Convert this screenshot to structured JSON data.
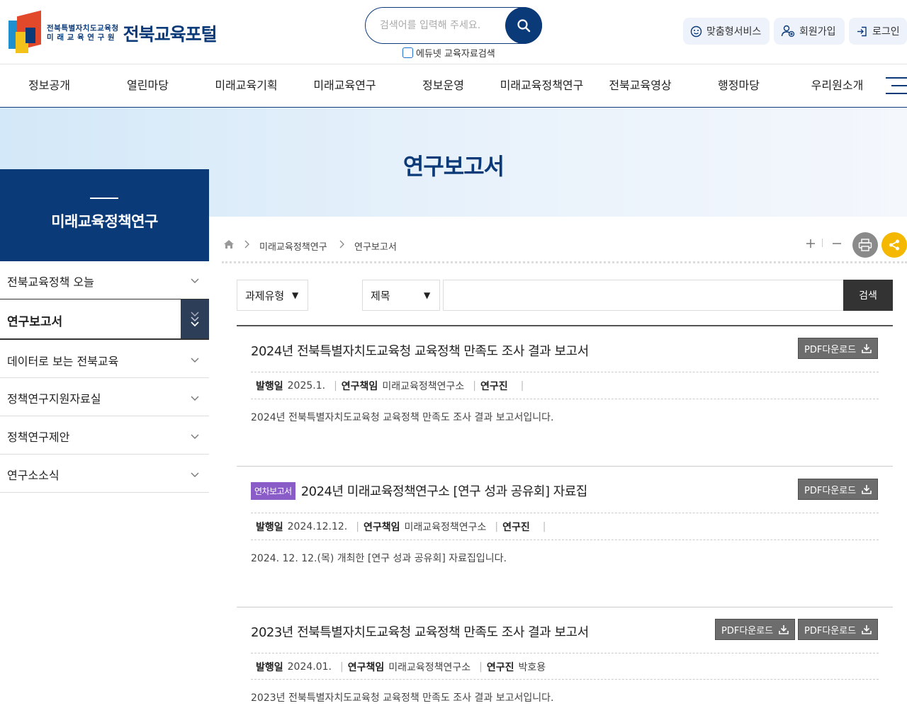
{
  "header": {
    "logo_line1": "전북특별자치도교육청",
    "logo_line2": "미 래 교 육 연 구 원",
    "logo_main": "전북교육포털",
    "search_placeholder": "검색어를 입력해 주세요.",
    "edunet_label": "에듀넷 교육자료검색",
    "util": [
      "맞춤형서비스",
      "회원가입",
      "로그인"
    ]
  },
  "gnb": [
    "정보공개",
    "열린마당",
    "미래교육기획",
    "미래교육연구",
    "정보운영",
    "미래교육정책연구",
    "전북교육영상",
    "행정마당",
    "우리원소개"
  ],
  "page_title": "연구보고서",
  "lnb": {
    "title": "미래교육정책연구",
    "items": [
      "전북교육정책 오늘",
      "연구보고서",
      "데이터로 보는 전북교육",
      "정책연구지원자료실",
      "정책연구제안",
      "연구소소식"
    ]
  },
  "breadcrumb": [
    "미래교육정책연구",
    "연구보고서"
  ],
  "filter": {
    "type_label": "과제유형",
    "field_label": "제목",
    "button": "검색"
  },
  "reports": [
    {
      "badge": "",
      "title": "2024년 전북특별자치도교육청 교육정책 만족도 조사 결과 보고서",
      "downloads": [
        "PDF다운로드"
      ],
      "meta": {
        "발행일": "2025.1.",
        "연구책임": "미래교육정책연구소",
        "연구진": ""
      },
      "desc": "2024년 전북특별자치도교육청 교육정책 만족도 조사 결과 보고서입니다."
    },
    {
      "badge": "연차보고서",
      "title": "2024년 미래교육정책연구소 [연구 성과 공유회] 자료집",
      "downloads": [
        "PDF다운로드"
      ],
      "meta": {
        "발행일": "2024.12.12.",
        "연구책임": "미래교육정책연구소",
        "연구진": ""
      },
      "desc": "2024. 12. 12.(목) 개최한 [연구 성과 공유회] 자료집입니다."
    },
    {
      "badge": "",
      "title": "2023년 전북특별자치도교육청 교육정책 만족도 조사 결과 보고서",
      "downloads": [
        "PDF다운로드",
        "PDF다운로드"
      ],
      "meta": {
        "발행일": "2024.01.",
        "연구책임": "미래교육정책연구소",
        "연구진": "박호용"
      },
      "desc": "2023년 전북특별자치도교육청 교육정책 만족도 조사 결과 보고서입니다."
    }
  ],
  "meta_labels": [
    "발행일",
    "연구책임",
    "연구진"
  ],
  "colors": {
    "primary": "#0b3a78",
    "share": "#f5b800",
    "print": "#8a8a8a",
    "badge": "#8a5cc8"
  }
}
